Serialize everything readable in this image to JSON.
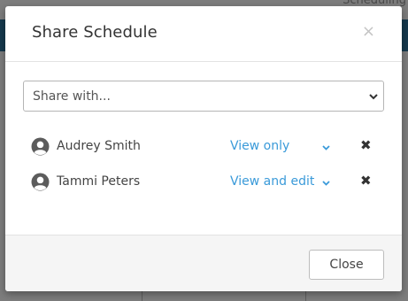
{
  "background": {
    "header_text": "Scheduling"
  },
  "modal": {
    "title": "Share Schedule",
    "close_icon": "×",
    "share_select": {
      "placeholder": "Share with..."
    },
    "shared_users": [
      {
        "name": "Audrey Smith",
        "permission": "View only",
        "icon": "user-circle-icon"
      },
      {
        "name": "Tammi Peters",
        "permission": "View and edit",
        "icon": "user-circle-icon"
      }
    ],
    "remove_icon": "✖",
    "close_button_label": "Close"
  },
  "colors": {
    "accent": "#3a9ad9",
    "header_bar": "#15394d",
    "overlay": "#7d7d7d"
  }
}
